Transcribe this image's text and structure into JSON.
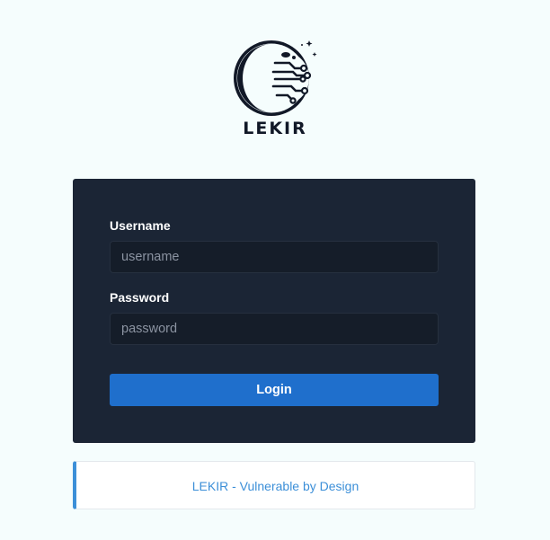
{
  "brand": {
    "name": "LEKIR",
    "logo_icon": "crescent-moon-circuit-logo",
    "text_color": "#111827"
  },
  "login_form": {
    "username_label": "Username",
    "username_placeholder": "username",
    "username_value": "",
    "password_label": "Password",
    "password_placeholder": "password",
    "password_value": "",
    "submit_label": "Login",
    "card_color": "#1b2535",
    "button_color": "#1f6fcc"
  },
  "footer": {
    "text": "LEKIR - Vulnerable by Design",
    "accent_color": "#3c8fd8"
  }
}
